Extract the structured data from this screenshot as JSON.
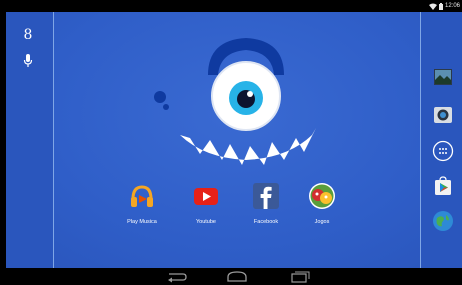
{
  "status_bar": {
    "time": "12:06",
    "wifi_icon": "wifi-icon",
    "battery_icon": "battery-icon"
  },
  "left_bar": {
    "search_icon": "google-search-icon",
    "search_glyph": "8",
    "voice_icon": "mic-icon"
  },
  "wallpaper": {
    "background_color": "#2f5ec8",
    "description_icon": "monster-wallpaper"
  },
  "apps": [
    {
      "label": "Play Musica",
      "icon": "headphones-icon",
      "color": "#f5a623"
    },
    {
      "label": "Youtube",
      "icon": "youtube-icon",
      "color": "#e62117"
    },
    {
      "label": "Facebook",
      "icon": "facebook-icon",
      "color": "#3b5998"
    },
    {
      "label": "Jogos",
      "icon": "angry-birds-icon",
      "color": "#d33"
    }
  ],
  "right_bar": {
    "items": [
      {
        "icon": "gallery-icon"
      },
      {
        "icon": "camera-icon"
      },
      {
        "icon": "apps-drawer-icon"
      },
      {
        "icon": "play-store-icon"
      },
      {
        "icon": "browser-globe-icon"
      }
    ]
  },
  "nav_bar": {
    "back_icon": "back-icon",
    "home_icon": "home-icon",
    "recents_icon": "recent-apps-icon"
  }
}
